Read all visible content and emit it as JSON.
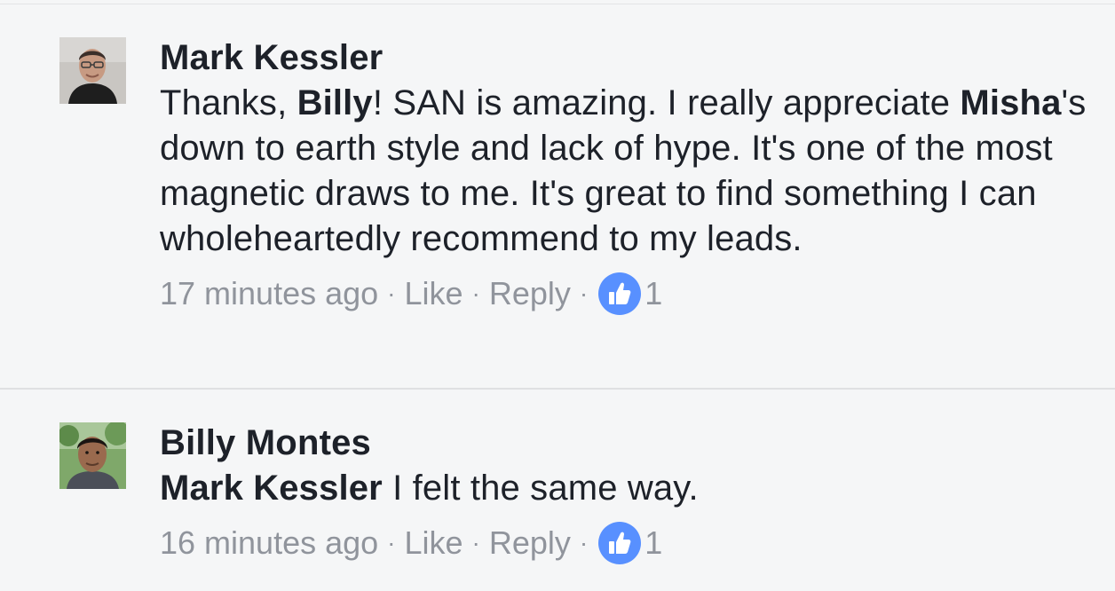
{
  "comments": [
    {
      "author": "Mark Kessler",
      "text_parts": {
        "p1": "Thanks, ",
        "b1": "Billy",
        "p2": "! SAN is amazing. I really appreciate ",
        "b2": "Misha",
        "p3": "'s down to earth style and lack of hype. It's one of the most magnetic draws to me. It's great to find something I can wholeheartedly recommend to my leads."
      },
      "time": "17 minutes ago",
      "like_label": "Like",
      "reply_label": "Reply",
      "reaction_icon": "thumbs-up-icon",
      "reaction_count": "1"
    },
    {
      "author": "Billy Montes",
      "text_parts": {
        "b1": "Mark Kessler",
        "p1": " I felt the same way."
      },
      "time": "16 minutes ago",
      "like_label": "Like",
      "reply_label": "Reply",
      "reaction_icon": "thumbs-up-icon",
      "reaction_count": "1"
    }
  ],
  "separator": "·",
  "colors": {
    "background": "#f5f6f7",
    "text": "#1d2129",
    "meta": "#90949c",
    "reaction": "#5890ff"
  }
}
